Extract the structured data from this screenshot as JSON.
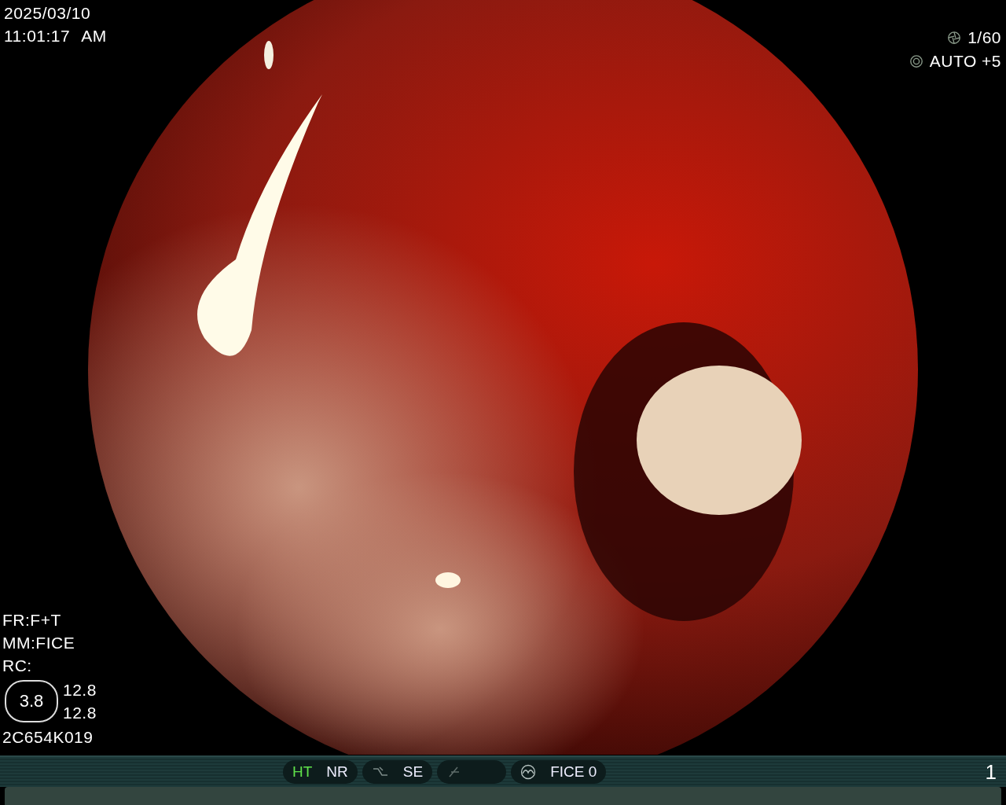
{
  "date": "2025/03/10",
  "time": "11:01:17",
  "meridiem": "AM",
  "camera": [
    {
      "kind": "shutter",
      "label": "1/60"
    },
    {
      "kind": "iris",
      "label": "AUTO +5"
    }
  ],
  "info": [
    "FR:F+T",
    "MM:FICE",
    "RC:"
  ],
  "gauge": {
    "value": "3.8",
    "readings": [
      "12.8",
      "12.8"
    ]
  },
  "serial": "2C654K019",
  "status_bar": {
    "groups": [
      {
        "kind": "text",
        "items": [
          {
            "label": "HT",
            "on": true
          },
          {
            "label": "NR",
            "on": false
          }
        ]
      },
      {
        "kind": "curve",
        "items": [
          {
            "label": "SE",
            "on": false
          }
        ]
      },
      {
        "kind": "slash"
      },
      {
        "kind": "wave",
        "items": [
          {
            "label": "FICE 0",
            "on": false
          }
        ]
      }
    ],
    "page": "1"
  }
}
